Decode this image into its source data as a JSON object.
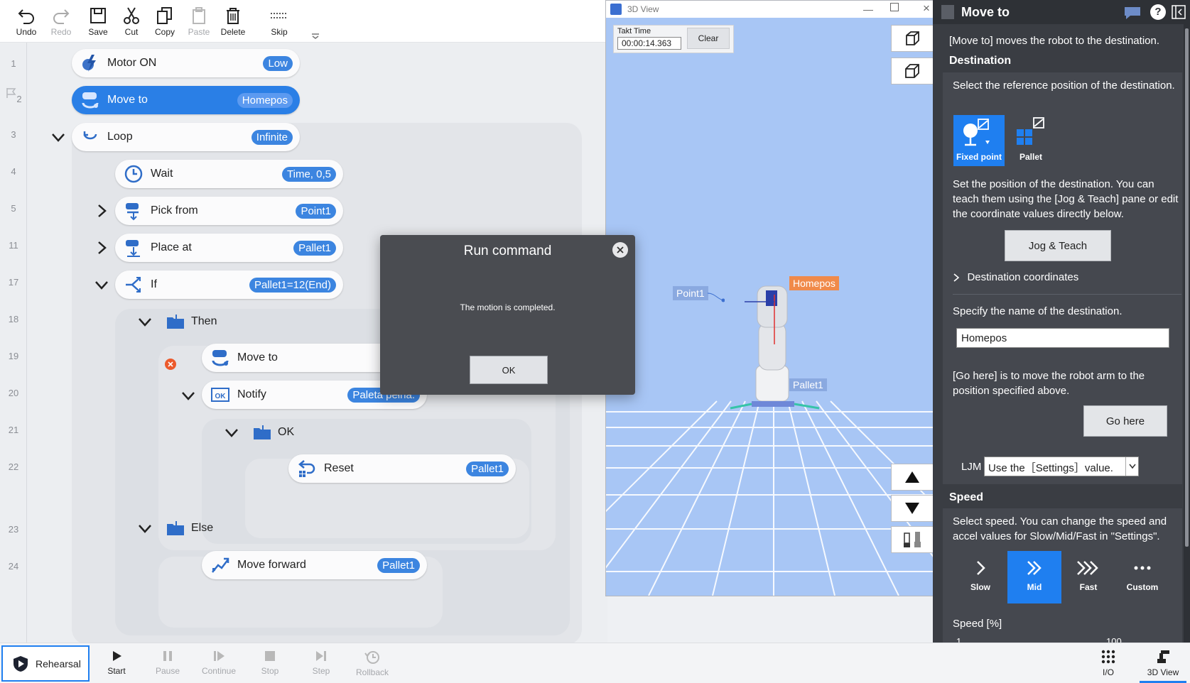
{
  "toolbar": {
    "undo": "Undo",
    "redo": "Redo",
    "save": "Save",
    "cut": "Cut",
    "copy": "Copy",
    "paste": "Paste",
    "delete": "Delete",
    "skip": "Skip"
  },
  "program": {
    "line_numbers": [
      "1",
      "2",
      "3",
      "4",
      "5",
      "11",
      "17",
      "18",
      "19",
      "20",
      "21",
      "22",
      "23",
      "24"
    ],
    "motor_on": {
      "label": "Motor ON",
      "param": "Low"
    },
    "move_to_1": {
      "label": "Move to",
      "param": "Homepos"
    },
    "loop": {
      "label": "Loop",
      "param": "Infinite"
    },
    "wait": {
      "label": "Wait",
      "param": "Time, 0,5"
    },
    "pick_from": {
      "label": "Pick from",
      "param": "Point1"
    },
    "place_at": {
      "label": "Place at",
      "param": "Pallet1"
    },
    "if_cmd": {
      "label": "If",
      "param": "Pallet1=12(End)"
    },
    "then": {
      "label": "Then"
    },
    "move_to_2": {
      "label": "Move to"
    },
    "notify": {
      "label": "Notify",
      "param": "Paleta pełna."
    },
    "ok_branch": {
      "label": "OK"
    },
    "reset": {
      "label": "Reset",
      "param": "Pallet1"
    },
    "else_branch": {
      "label": "Else"
    },
    "move_forward": {
      "label": "Move forward",
      "param": "Pallet1"
    }
  },
  "view3d": {
    "title": "3D View",
    "takt_label": "Takt Time",
    "takt_value": "00:00:14.363",
    "clear": "Clear",
    "point1": "Point1",
    "homepos": "Homepos",
    "pallet1": "Pallet1"
  },
  "dialog": {
    "title": "Run command",
    "message": "The motion is completed.",
    "ok": "OK"
  },
  "panel": {
    "title": "Move to",
    "intro": "[Move to] moves the robot to the destination.",
    "destination_heading": "Destination",
    "ref_text": "Select the reference position of the destination.",
    "fixed_point": "Fixed point",
    "pallet": "Pallet",
    "set_text": "Set the position of the destination. You can teach them using the [Jog & Teach] pane or edit the coordinate values directly below.",
    "jog_teach": "Jog & Teach",
    "dest_coords": "Destination coordinates",
    "name_text": "Specify the name of the destination.",
    "name_value": "Homepos",
    "go_here_text": "[Go here] is to move the robot arm to the position specified above.",
    "go_here": "Go here",
    "ljm_label": "LJM",
    "ljm_value": "Use the［Settings］value.",
    "speed_heading": "Speed",
    "speed_text": "Select speed. You can change the speed and accel values for Slow/Mid/Fast in \"Settings\".",
    "slow": "Slow",
    "mid": "Mid",
    "fast": "Fast",
    "custom": "Custom",
    "speed_pct": "Speed [%]",
    "speed_min": "1",
    "speed_max": "100"
  },
  "bottom": {
    "rehearsal": "Rehearsal",
    "start": "Start",
    "pause": "Pause",
    "continue": "Continue",
    "stop": "Stop",
    "step": "Step",
    "rollback": "Rollback",
    "io": "I/O",
    "view3d": "3D View"
  },
  "colors": {
    "accent": "#2a7fe6",
    "pill": "#3c85e0",
    "panel": "#3a3d43",
    "scene": "#a8c6f5"
  }
}
